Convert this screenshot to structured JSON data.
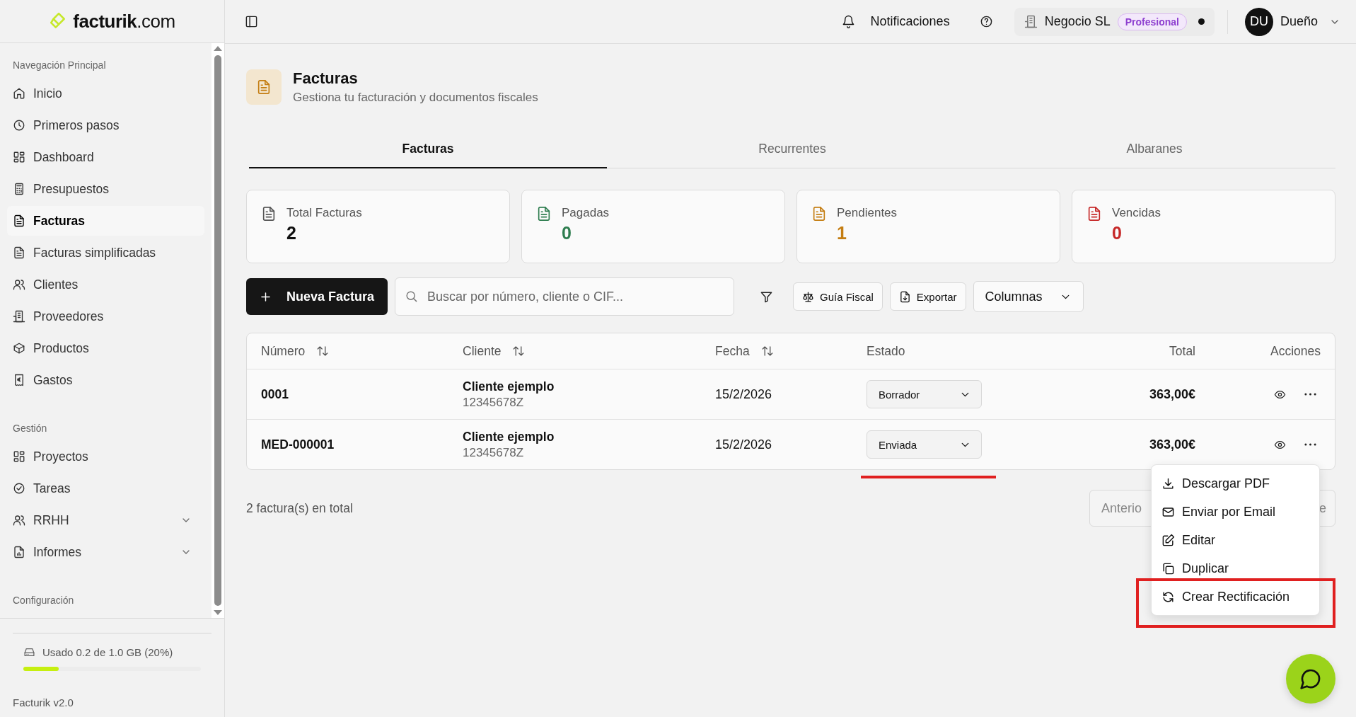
{
  "brand": {
    "name": "facturik",
    "suffix": ".com"
  },
  "sidebar": {
    "sections": [
      {
        "title": "Navegación Principal",
        "items": [
          {
            "label": "Inicio",
            "selected": false
          },
          {
            "label": "Primeros pasos",
            "selected": false
          },
          {
            "label": "Dashboard",
            "selected": false
          },
          {
            "label": "Presupuestos",
            "selected": false
          },
          {
            "label": "Facturas",
            "selected": true
          },
          {
            "label": "Facturas simplificadas",
            "selected": false
          },
          {
            "label": "Clientes",
            "selected": false
          },
          {
            "label": "Proveedores",
            "selected": false
          },
          {
            "label": "Productos",
            "selected": false
          },
          {
            "label": "Gastos",
            "selected": false
          }
        ]
      },
      {
        "title": "Gestión",
        "items": [
          {
            "label": "Proyectos",
            "selected": false
          },
          {
            "label": "Tareas",
            "selected": false
          },
          {
            "label": "RRHH",
            "selected": false,
            "expanded": false
          },
          {
            "label": "Informes",
            "selected": false,
            "expanded": false
          }
        ]
      },
      {
        "title": "Configuración"
      }
    ],
    "storage": {
      "text": "Usado 0.2 de 1.0 GB (20%)",
      "level": 0.2
    },
    "version": "Facturik v2.0"
  },
  "header": {
    "notifications": "Notificaciones",
    "company": "Negocio SL",
    "plan": "Profesional",
    "avatar": "DU",
    "user": "Dueño"
  },
  "page": {
    "title": "Facturas",
    "subtitle": "Gestiona tu facturación y documentos fiscales"
  },
  "tabs": [
    {
      "label": "Facturas",
      "selected": true
    },
    {
      "label": "Recurrentes",
      "selected": false
    },
    {
      "label": "Albaranes",
      "selected": false
    }
  ],
  "stats": [
    {
      "label": "Total Facturas",
      "value": "2",
      "color": "#555555"
    },
    {
      "label": "Pagadas",
      "value": "0",
      "color": "#2e7d4f"
    },
    {
      "label": "Pendientes",
      "value": "1",
      "color": "#c47d12"
    },
    {
      "label": "Vencidas",
      "value": "0",
      "color": "#c62828"
    }
  ],
  "toolbar": {
    "new_button": "Nueva Factura",
    "search": {
      "placeholder": "Buscar por número, cliente o CIF..."
    },
    "guide_button": "Guía Fiscal",
    "export_button": "Exportar",
    "columns_button": "Columnas"
  },
  "table": {
    "columns": [
      {
        "label": "Número",
        "sortable": true
      },
      {
        "label": "Cliente",
        "sortable": true
      },
      {
        "label": "Fecha",
        "sortable": true
      },
      {
        "label": "Estado",
        "sortable": false
      },
      {
        "label": "Total",
        "sortable": false
      },
      {
        "label": "Acciones",
        "sortable": false
      }
    ],
    "rows": [
      {
        "number": "0001",
        "client": "Cliente ejemplo",
        "tax_id": "12345678Z",
        "date": "15/2/2026",
        "status": "Borrador",
        "total": "363,00€"
      },
      {
        "number": "MED-000001",
        "client": "Cliente ejemplo",
        "tax_id": "12345678Z",
        "date": "15/2/2026",
        "status": "Enviada",
        "total": "363,00€"
      }
    ]
  },
  "footer": {
    "count": "2 factura(s) en total",
    "previous": "Anterio",
    "next": "e"
  },
  "menu": {
    "items": [
      "Descargar PDF",
      "Enviar por Email",
      "Editar",
      "Duplicar",
      "Crear Rectificación"
    ]
  },
  "annotations": [
    {
      "kind": "underline"
    },
    {
      "kind": "box"
    }
  ]
}
